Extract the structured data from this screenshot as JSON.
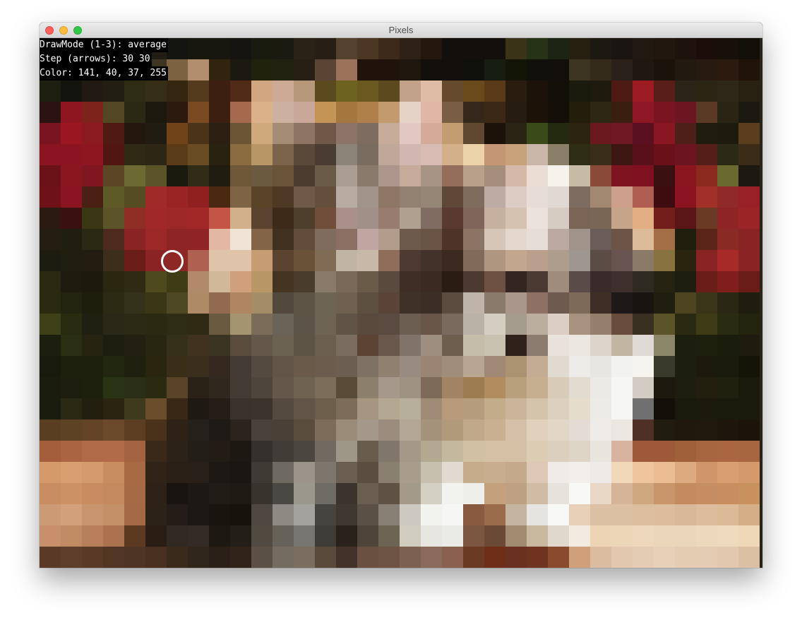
{
  "window": {
    "title": "Pixels",
    "controls": [
      "close",
      "minimize",
      "zoom"
    ]
  },
  "overlay": {
    "draw_mode": "DrawMode (1-3): average",
    "step": "Step (arrows): 30 30",
    "color": "Color: 141, 40, 37, 255"
  },
  "mosaic": {
    "cell_size_label": "30 30",
    "selected_color": "#8d2825",
    "rows": [
      [
        "#141510",
        "#141510",
        "#141510",
        "#1c1a10",
        "#1e1c14",
        "#221d12",
        "#141510",
        "#171710",
        "#171710",
        "#151410",
        "#181b0e",
        "#1b1a10",
        "#2a2216",
        "#271e16",
        "#54412e",
        "#4b3722",
        "#3d2a1a",
        "#2e2216",
        "#24170e",
        "#130f0c",
        "#120f0c",
        "#120f0c",
        "#3a3318",
        "#263316",
        "#1c2514",
        "#271f10",
        "#1c1a10",
        "#1a1510",
        "#201a12",
        "#21170e",
        "#1d130c",
        "#1b0e0a",
        "#171008",
        "#120e08"
      ],
      [
        "#191a10",
        "#141510",
        "#141510",
        "#141510",
        "#1c1a10",
        "#3e3422",
        "#7d6242",
        "#b28e6e",
        "#31230e",
        "#1c1a10",
        "#21220c",
        "#222210",
        "#271e14",
        "#5a4534",
        "#9b715a",
        "#21120b",
        "#22120c",
        "#1f170e",
        "#120f0c",
        "#120f0c",
        "#0f100a",
        "#171d10",
        "#131507",
        "#11100a",
        "#120e0c",
        "#3e3422",
        "#352b1a",
        "#29211a",
        "#1f1810",
        "#1b120c",
        "#221a10",
        "#281a10",
        "#2c1a0e",
        "#201408"
      ],
      [
        "#1f1f10",
        "#14140f",
        "#201a12",
        "#231e14",
        "#2e2d12",
        "#362f16",
        "#34260f",
        "#553b1d",
        "#3d1f12",
        "#522a18",
        "#d3a682",
        "#cca994",
        "#b8987a",
        "#5a4a1e",
        "#6d6220",
        "#6b5a1f",
        "#5a4a1e",
        "#c1a187",
        "#dfbca6",
        "#654a2e",
        "#6a4a1a",
        "#5a3a18",
        "#2a1c0e",
        "#1c120a",
        "#120e08",
        "#1a1b0c",
        "#1e1a0e",
        "#4e1a14",
        "#9d1c24",
        "#5a1e18",
        "#2c2416",
        "#2b2514",
        "#2d2818",
        "#282010"
      ],
      [
        "#2a1310",
        "#8d1620",
        "#7e221c",
        "#534726",
        "#2a2a14",
        "#1b180d",
        "#2c1a0e",
        "#7a4a22",
        "#3d1f12",
        "#a46a4e",
        "#dbb18a",
        "#ccb0a0",
        "#c9a89a",
        "#c49356",
        "#a4773e",
        "#b0804a",
        "#c29a6e",
        "#e5d3c8",
        "#e0b7a6",
        "#7a5e44",
        "#35271a",
        "#3b2916",
        "#271c10",
        "#1c1208",
        "#140e08",
        "#231e0c",
        "#2d2814",
        "#3a1f10",
        "#8d1823",
        "#7a1420",
        "#6c1622",
        "#5a3a24",
        "#2a2414",
        "#1c1a10"
      ],
      [
        "#7a1420",
        "#9a1620",
        "#8a1a20",
        "#4e1a12",
        "#24180e",
        "#211c12",
        "#704418",
        "#4a3316",
        "#2a1f10",
        "#6a5534",
        "#cfa87c",
        "#a58c77",
        "#8e7463",
        "#6f5848",
        "#8c7568",
        "#7e6c60",
        "#c6ac98",
        "#e2c8c2",
        "#d4aa98",
        "#c49c72",
        "#604830",
        "#1c120a",
        "#2a2414",
        "#3a4a18",
        "#242a10",
        "#2c2410",
        "#6a1a1e",
        "#701824",
        "#5a1020",
        "#8a1622",
        "#4e1e18",
        "#201c0e",
        "#1d1b0e",
        "#5a3e1e"
      ],
      [
        "#8a1420",
        "#8a1420",
        "#8e1620",
        "#521610",
        "#2e2a14",
        "#2d2614",
        "#5a3c18",
        "#6a4c24",
        "#2a2210",
        "#8a6c40",
        "#b89666",
        "#7c644c",
        "#5a4838",
        "#4a3c30",
        "#8d8478",
        "#7b6c60",
        "#bfa89a",
        "#d0b8b0",
        "#d8bcb4",
        "#d4b08a",
        "#ecd2a8",
        "#c49676",
        "#c8a07a",
        "#cab6a8",
        "#8a8068",
        "#2f2c14",
        "#3a2e18",
        "#3e1612",
        "#5a1018",
        "#6a1018",
        "#6c1420",
        "#561e18",
        "#2a2a16",
        "#3a2c16"
      ],
      [
        "#6a1218",
        "#8a1620",
        "#801620",
        "#5a4624",
        "#6c6a32",
        "#5a5428",
        "#1a1a0e",
        "#302c18",
        "#201c10",
        "#6e5838",
        "#6c5a40",
        "#6a5438",
        "#4c3c30",
        "#6a5a48",
        "#aa9e94",
        "#8a7a6c",
        "#ad968c",
        "#c6aa9a",
        "#a89484",
        "#946e5a",
        "#b8a08a",
        "#a58e7a",
        "#d6b8a8",
        "#ebddd4",
        "#f6f2ec",
        "#c6bca6",
        "#8a4a3a",
        "#7e1420",
        "#7e1020",
        "#3a1010",
        "#8a1620",
        "#8a2a1e",
        "#6a6a30",
        "#1c1a10"
      ],
      [
        "#6e1218",
        "#8a1420",
        "#4a2012",
        "#5e5a28",
        "#554c22",
        "#a02a28",
        "#9a2424",
        "#902020",
        "#4a2812",
        "#7e6444",
        "#5a4428",
        "#4e3a24",
        "#6e5a46",
        "#644e3c",
        "#b8aca2",
        "#a09488",
        "#8e7664",
        "#928070",
        "#968676",
        "#604838",
        "#806c5c",
        "#beaca4",
        "#dcccc4",
        "#e8dcd6",
        "#e0d8d2",
        "#7e6c60",
        "#a28870",
        "#cea08c",
        "#b05e52",
        "#3e0c0e",
        "#8c1420",
        "#a03028",
        "#902a28",
        "#9a2028"
      ],
      [
        "#2a1a10",
        "#3a1010",
        "#3a3814",
        "#5a5428",
        "#8e2e24",
        "#a02828",
        "#9c2828",
        "#a22828",
        "#c45446",
        "#d2b08c",
        "#5a4430",
        "#3e2a18",
        "#4e3e2c",
        "#704e3a",
        "#a89088",
        "#a09088",
        "#987c70",
        "#b0a090",
        "#806c60",
        "#5a3a30",
        "#80665a",
        "#c6b0a0",
        "#d6c2b0",
        "#ece2dc",
        "#d6ccc2",
        "#7a6456",
        "#7a6654",
        "#c6a48a",
        "#e4ae84",
        "#721e1a",
        "#5a1616",
        "#6a3a24",
        "#8e2424",
        "#9a2426"
      ],
      [
        "#241e12",
        "#201e0e",
        "#2a2a14",
        "#4e2a1e",
        "#8a2424",
        "#9c2828",
        "#8e2424",
        "#902424",
        "#e2b8a2",
        "#f0e4d6",
        "#846446",
        "#403020",
        "#624c3a",
        "#806c5e",
        "#8c7064",
        "#c0a6a0",
        "#b29c8c",
        "#6e5a4c",
        "#6a5446",
        "#4e3428",
        "#8c7464",
        "#d6c6b8",
        "#e4d8cc",
        "#e6ded6",
        "#bcaaa0",
        "#a0948a",
        "#6a5c58",
        "#6c5446",
        "#dcbc98",
        "#a46e46",
        "#201f0e",
        "#5a2418",
        "#8a2a24",
        "#8a2424"
      ],
      [
        "#1c1c10",
        "#201e0e",
        "#231c10",
        "#3c2e1a",
        "#6a1c18",
        "#8a2424",
        "#8d2825",
        "#b06050",
        "#e0c4aa",
        "#e0c4aa",
        "#c69c72",
        "#5a4430",
        "#6a5238",
        "#806c54",
        "#c0b4a4",
        "#c8b8a8",
        "#8e6e5a",
        "#4e3a30",
        "#42322a",
        "#3c2a20",
        "#806a5a",
        "#ae9680",
        "#c2a68e",
        "#baa08c",
        "#ae9c8c",
        "#9e9690",
        "#5c4c46",
        "#6a5452",
        "#8c7a68",
        "#887240",
        "#2a240e",
        "#8a2424",
        "#a82a28",
        "#8a2424"
      ],
      [
        "#2a2a10",
        "#1e1c0e",
        "#1c1a0c",
        "#2a2610",
        "#2e2a14",
        "#4e4a1e",
        "#3e3c14",
        "#b08a6a",
        "#d0b898",
        "#d0a07c",
        "#b89666",
        "#443420",
        "#4a3c2c",
        "#8a7a6a",
        "#7a6858",
        "#6a5a48",
        "#5a4a3e",
        "#3e2e24",
        "#3a2a22",
        "#2a1c10",
        "#4c3a30",
        "#6e5042",
        "#342422",
        "#4a3a32",
        "#a08c7c",
        "#5a4a48",
        "#3a2a2a",
        "#3e2e2c",
        "#2e2a22",
        "#262212",
        "#1e1e10",
        "#6a1c18",
        "#801e1c",
        "#6a1c18"
      ],
      [
        "#2a2a10",
        "#232410",
        "#1e1e0c",
        "#2c2a12",
        "#34321a",
        "#3a3814",
        "#4e4824",
        "#ae8a66",
        "#926a50",
        "#b08662",
        "#a48c66",
        "#52483c",
        "#5e5446",
        "#6e6454",
        "#706050",
        "#5e5040",
        "#5a4438",
        "#3e3228",
        "#3a2e26",
        "#5c4c40",
        "#beb4a8",
        "#8a7a6c",
        "#aa968a",
        "#8e7064",
        "#6e5a4e",
        "#7e6a58",
        "#3e2e26",
        "#1e1818",
        "#1a1410",
        "#201e0e",
        "#4e4422",
        "#3a3418",
        "#2a2814",
        "#1f1e0e"
      ],
      [
        "#3e4018",
        "#2a2c10",
        "#202010",
        "#2a2816",
        "#2c2a14",
        "#2a2a12",
        "#2e2c14",
        "#2e2a14",
        "#6a5a40",
        "#a49470",
        "#7a6c58",
        "#6a6458",
        "#5c5446",
        "#6e6454",
        "#605446",
        "#5a4a3e",
        "#5a4a40",
        "#6c5e50",
        "#6a5648",
        "#7a6a5e",
        "#bab2a6",
        "#d4cec2",
        "#a69c8e",
        "#bcae9e",
        "#dccec4",
        "#a6927e",
        "#94806a",
        "#6a4c3c",
        "#3a3022",
        "#5a5428",
        "#2a2a12",
        "#3e3c16",
        "#2a2c12",
        "#22240e"
      ],
      [
        "#1c1f0e",
        "#2a2e12",
        "#262410",
        "#1e1e0e",
        "#222010",
        "#282610",
        "#34301a",
        "#40321e",
        "#3a3422",
        "#5a4c3c",
        "#64584a",
        "#6c6252",
        "#5e5446",
        "#6a5e4e",
        "#7a6c5e",
        "#5c4434",
        "#6a584c",
        "#80746a",
        "#9e8e80",
        "#6e5e4e",
        "#c6bcaa",
        "#cac2b0",
        "#2e221a",
        "#8c7c70",
        "#e8e2da",
        "#ebe6e0",
        "#dcd4ca",
        "#c0b6a2",
        "#e0dad6",
        "#8c8668",
        "#1c1e0e",
        "#1e200e",
        "#1a1c0c",
        "#1e1c0e"
      ],
      [
        "#181a0e",
        "#1e200e",
        "#1e200e",
        "#222810",
        "#20200e",
        "#2a260e",
        "#3a2e18",
        "#3a2e1c",
        "#34281e",
        "#443c34",
        "#544a40",
        "#625446",
        "#6a5a4a",
        "#6c5c4e",
        "#6c5e50",
        "#7e7264",
        "#908070",
        "#988c80",
        "#9a8474",
        "#a08e7a",
        "#b8a692",
        "#a08a76",
        "#ab9270",
        "#c4ac94",
        "#e0dad0",
        "#eeece8",
        "#e8e6e2",
        "#f2f2f0",
        "#f6f4ee",
        "#3a3a2a",
        "#1c1e0e",
        "#1c1a0c",
        "#1a1a0c",
        "#141408"
      ],
      [
        "#1a1c0e",
        "#1e1e0e",
        "#1e200e",
        "#283414",
        "#2a2e16",
        "#2a2a10",
        "#5a4428",
        "#2a2216",
        "#2e281e",
        "#443c34",
        "#4e463c",
        "#64584a",
        "#6e6250",
        "#7c6c5a",
        "#5a4a38",
        "#8c806c",
        "#a6988a",
        "#9e9282",
        "#7e6a58",
        "#a28464",
        "#9e7c52",
        "#b08c5e",
        "#b8a07c",
        "#c6ae90",
        "#d8ccb8",
        "#e2dcd0",
        "#eceae6",
        "#f6f6f4",
        "#d2ccc4",
        "#1c1a0e",
        "#1e1e0e",
        "#221f0e",
        "#20200e",
        "#1a1a0c"
      ],
      [
        "#1a1c0e",
        "#2a2a14",
        "#221f0e",
        "#2a2410",
        "#3e3a1e",
        "#6a4e2c",
        "#3a2816",
        "#1e1a12",
        "#261e16",
        "#3a322c",
        "#3c342c",
        "#544a40",
        "#625446",
        "#6c5e4a",
        "#7c6c58",
        "#a69680",
        "#b4a890",
        "#b8ae9c",
        "#a08c76",
        "#b69a7a",
        "#b49c7c",
        "#c2ac8a",
        "#cab49a",
        "#d4c4ac",
        "#ded0be",
        "#e6dccc",
        "#ecebe6",
        "#f6f6f4",
        "#707070",
        "#110f08",
        "#1a1a0c",
        "#1c1a0c",
        "#1a1a0c",
        "#1a1a0c"
      ],
      [
        "#5a3e22",
        "#5e4224",
        "#644426",
        "#6a4a2a",
        "#5c3e22",
        "#4a321a",
        "#2e2216",
        "#24201a",
        "#1e1a16",
        "#2a241c",
        "#4a423a",
        "#4a4038",
        "#5a4c3c",
        "#7c6c58",
        "#9a8c78",
        "#a4988a",
        "#9c8c7e",
        "#b4a694",
        "#a4927a",
        "#b09a7a",
        "#c0a88a",
        "#c8b090",
        "#d4c0a8",
        "#e0d0bc",
        "#e2d6c6",
        "#e4dcd4",
        "#eeebe8",
        "#ece6e0",
        "#4e3026",
        "#201c0e",
        "#20180c",
        "#201a0e",
        "#1e160c",
        "#1a140a"
      ],
      [
        "#a45e3c",
        "#aa6442",
        "#b06a48",
        "#b06a48",
        "#a46442",
        "#3a2818",
        "#2c2218",
        "#241e18",
        "#221c14",
        "#1e1812",
        "#36302c",
        "#403c36",
        "#4c4640",
        "#726a60",
        "#9e9686",
        "#6a5c4c",
        "#80766a",
        "#a49888",
        "#b4a890",
        "#c4b89e",
        "#d2c0a2",
        "#d4c0a2",
        "#d4c0a4",
        "#dcccb4",
        "#dccfbe",
        "#ddd4c6",
        "#e8e4de",
        "#d8b4a0",
        "#9e5a38",
        "#9e5a38",
        "#a0603a",
        "#a86640",
        "#aa6640",
        "#a86640"
      ],
      [
        "#d49a6a",
        "#d8a070",
        "#d49c6c",
        "#c88e60",
        "#a86a42",
        "#302418",
        "#2a2018",
        "#282018",
        "#1e1814",
        "#1a1612",
        "#3e3a34",
        "#6e6a62",
        "#9a948a",
        "#7c766c",
        "#6a5e50",
        "#5a4e40",
        "#8a8070",
        "#aa9c8a",
        "#c8c0ae",
        "#e2dad0",
        "#c6ac8a",
        "#c8ae8e",
        "#c4aa8a",
        "#dcc8b4",
        "#f0ebe6",
        "#f2efea",
        "#eeeae8",
        "#f0d8b8",
        "#eec49c",
        "#ecbc92",
        "#dcaa7e",
        "#d0966a",
        "#d8a070",
        "#d49a6c"
      ],
      [
        "#c88e62",
        "#cc9264",
        "#c88c60",
        "#c48a5e",
        "#a66a44",
        "#2e2218",
        "#1a1410",
        "#1e1814",
        "#221c16",
        "#1e1a14",
        "#38332c",
        "#4a4842",
        "#9a988c",
        "#6e6c64",
        "#3a342c",
        "#6a5e50",
        "#5e5244",
        "#a49a8a",
        "#d4d0c4",
        "#f2f2ee",
        "#eeeeea",
        "#c4a07c",
        "#bea082",
        "#d0bca4",
        "#e6e2dc",
        "#f8f8f6",
        "#ead8c6",
        "#d6b498",
        "#d0a880",
        "#c8966a",
        "#c48c5e",
        "#c48e62",
        "#c88e60",
        "#c8925e"
      ],
      [
        "#cc9a74",
        "#d2a07a",
        "#c8946e",
        "#c49068",
        "#a46a46",
        "#2c2218",
        "#241c16",
        "#1c1814",
        "#18140e",
        "#16120c",
        "#4e4840",
        "#8c8a82",
        "#a4a29c",
        "#46443e",
        "#3e3830",
        "#5a5044",
        "#888074",
        "#cccac0",
        "#f2f2ee",
        "#f6f6f4",
        "#8a5a40",
        "#9a6c4c",
        "#c4b4a0",
        "#e6e4e0",
        "#f8f8f6",
        "#e8d0b8",
        "#dcc0a4",
        "#dcc0a4",
        "#dcbe9e",
        "#dcbc9c",
        "#d8b898",
        "#dcbc9c",
        "#dcba98",
        "#d4ae86"
      ],
      [
        "#c8906a",
        "#c08a62",
        "#b8805a",
        "#aa724e",
        "#5c3a22",
        "#2a1e14",
        "#302a22",
        "#342c24",
        "#1e1812",
        "#241e18",
        "#504a40",
        "#66625a",
        "#787670",
        "#3e3c36",
        "#28221a",
        "#4e4438",
        "#6e6454",
        "#d0ccbe",
        "#e8e6e0",
        "#eaeae6",
        "#7c5640",
        "#6a4a36",
        "#a28c70",
        "#c8b89e",
        "#e0d8cc",
        "#f2ebe2",
        "#ecd4b4",
        "#ecd6b8",
        "#eed8bc",
        "#ead6b8",
        "#ead6b8",
        "#ecd8ba",
        "#eedabc",
        "#eed8b8"
      ],
      [
        "#5a3a26",
        "#5e3e2a",
        "#583a26",
        "#523624",
        "#4e3422",
        "#4a3020",
        "#3a2a1c",
        "#30261a",
        "#2a2018",
        "#302418",
        "#5a5044",
        "#746c60",
        "#7a6e60",
        "#5a4a3c",
        "#42322a",
        "#6a5040",
        "#6e5444",
        "#7c6050",
        "#8a6a58",
        "#8a6050",
        "#6a3a22",
        "#6e2e18",
        "#6a3020",
        "#6e3420",
        "#8a4a2e",
        "#d0a07a",
        "#dcbca0",
        "#e2c8ae",
        "#e4ccb4",
        "#e6d0b8",
        "#e4ccb2",
        "#e4ccb4",
        "#e2c8ae",
        "#dcc0a4"
      ],
      [
        "#584a44",
        "#5a4c46",
        "#564842",
        "#54463e",
        "#524540",
        "#50443e",
        "#4e423a",
        "#4e4038",
        "#4c3e36",
        "#50443c",
        "#645a50",
        "#6e6458",
        "#705e50",
        "#685448",
        "#604c42",
        "#6c5448",
        "#705848",
        "#6a5446",
        "#725a4a",
        "#7a6050",
        "#7a5a48",
        "#7a5646",
        "#7a5848",
        "#80604e",
        "#8a6a56",
        "#a08470",
        "#b49c84",
        "#bca48c",
        "#c0aa92",
        "#c4ae96",
        "#c8b29a",
        "#c8b09a",
        "#c8b098",
        "#c4aa92"
      ]
    ]
  }
}
